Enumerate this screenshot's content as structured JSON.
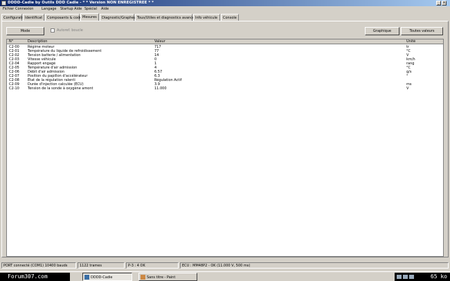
{
  "window": {
    "title": "DDDD-Cadie by Outils DDD Cadie - * * Version NON ENREGISTREE * *"
  },
  "menu": [
    "Fichier",
    "Connexion",
    "Langage",
    "Startup Aide",
    "Spécial",
    "Aide"
  ],
  "tabs": [
    {
      "label": "Configuration",
      "active": false
    },
    {
      "label": "Identificat",
      "active": false
    },
    {
      "label": "Composants & codes",
      "active": false
    },
    {
      "label": "Mesures",
      "active": true
    },
    {
      "label": "Diagnostic/Grapheurs",
      "active": false
    },
    {
      "label": "Tous/Utiles et diagnostics avancés",
      "active": false
    },
    {
      "label": "Info véhicule",
      "active": false
    },
    {
      "label": "Console",
      "active": false
    }
  ],
  "toolbar": {
    "mode_button": "Mode",
    "checkbox_label": "Autoref. boucle",
    "graph_button": "Graphique",
    "all_values_button": "Toutes valeurs"
  },
  "grid": {
    "headers": [
      "N°",
      "Description",
      "Valeur",
      "Unité"
    ],
    "rows": [
      [
        "C2-00",
        "Régime moteur",
        "717",
        "tr"
      ],
      [
        "C2-01",
        "Température du liquide de refroidissement",
        "77",
        "°C"
      ],
      [
        "C2-02",
        "Tension batterie / alimentation",
        "14",
        "V"
      ],
      [
        "C2-03",
        "Vitesse véhicule",
        "0",
        "km/h"
      ],
      [
        "C2-04",
        "Rapport engagé",
        "1",
        "rang"
      ],
      [
        "C2-05",
        "Température d'air admission",
        "4",
        "°C"
      ],
      [
        "C2-06",
        "Débit d'air admission",
        "6.57",
        "g/s"
      ],
      [
        "C2-07",
        "Position du papillon d'accélérateur",
        "6.3",
        "°"
      ],
      [
        "C2-08",
        "Etat de la régulation ralenti",
        "Régulation Actif",
        ""
      ],
      [
        "C2-09",
        "Durée d'injection calculée (ECU)",
        "3.9",
        "ms"
      ],
      [
        "C2-10",
        "Tension de la sonde à oxygène amont",
        "11.000",
        "V"
      ]
    ]
  },
  "status": [
    "PORT connecté (COM1) 10400 bauds",
    "1122 trames",
    "P-3 : 4 OK",
    "ECU : MM48P2 - OK (11.000 V, 500 ms)"
  ],
  "taskbar": {
    "start_label": "Forum307.com",
    "tasks": [
      {
        "label": "DDDD-Cadie",
        "active": true
      },
      {
        "label": "Sans titre - Paint",
        "active": false
      }
    ],
    "tray_kb": "65 ko"
  }
}
